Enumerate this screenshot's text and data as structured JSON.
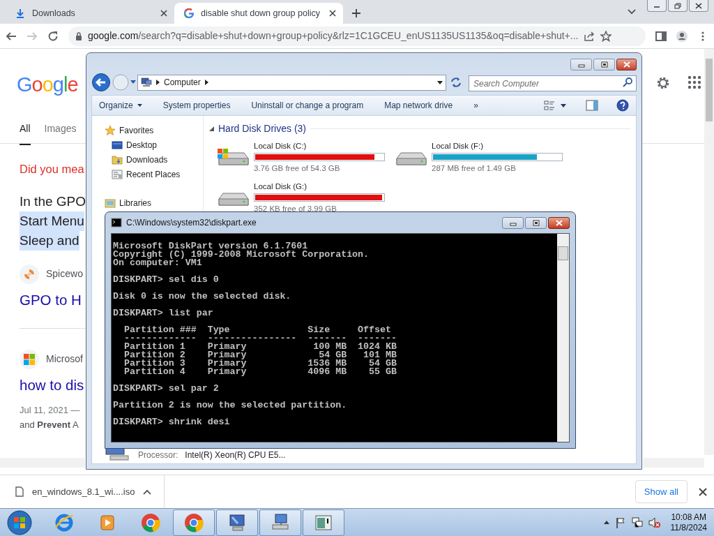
{
  "browser": {
    "tabs": [
      {
        "kind": "downloads",
        "title": "Downloads",
        "selected": false
      },
      {
        "kind": "google",
        "title": "disable shut down group policy",
        "selected": true
      }
    ],
    "back": {
      "disabled": false
    },
    "forward": {
      "disabled": true
    },
    "url": {
      "host": "google.com",
      "rest": "/search?q=disable+shut+down+group+policy&rlz=1C1GCEU_enUS1135US1135&oq=disable+shut+..."
    }
  },
  "google": {
    "logo": "Google",
    "search_tabs": [
      {
        "label": "All",
        "selected": true
      },
      {
        "label": "Images",
        "selected": false
      }
    ],
    "did_you_mean": "Did you mea",
    "snippet_lines": [
      {
        "text": "In the GPO",
        "highlighted": false
      },
      {
        "text": "Start Menu",
        "highlighted": true
      },
      {
        "text": "Sleep and",
        "highlighted": true
      }
    ],
    "results": [
      {
        "kind": "spiceworks",
        "source": "Spicewo",
        "title": "GPO to H"
      },
      {
        "kind": "microsoft",
        "source": "Microsof",
        "title": "how to dis",
        "date": "Jul 11, 2021 —",
        "snippet": "and **Prevent** A"
      }
    ]
  },
  "explorer": {
    "address": [
      "Computer"
    ],
    "search_placeholder": "Search Computer",
    "toolbar": [
      {
        "kind": "menu",
        "label": "Organize"
      },
      {
        "kind": "command",
        "label": "System properties"
      },
      {
        "kind": "command",
        "label": "Uninstall or change a program"
      },
      {
        "kind": "command",
        "label": "Map network drive"
      },
      {
        "kind": "command",
        "label": "»"
      }
    ],
    "nav": [
      {
        "kind": "favorites",
        "label": "Favorites",
        "children": [
          {
            "kind": "desktop",
            "label": "Desktop"
          },
          {
            "kind": "downloads",
            "label": "Downloads"
          },
          {
            "kind": "recent",
            "label": "Recent Places"
          }
        ]
      },
      {
        "kind": "libraries",
        "label": "Libraries"
      }
    ],
    "group": {
      "title": "Hard Disk Drives (3)",
      "expanded": true
    },
    "drives": [
      {
        "name": "Local Disk (C:)",
        "system": true,
        "level": 0.93,
        "color": "#e01010",
        "free": "3.76 GB free of 54.3 GB"
      },
      {
        "name": "Local Disk (F:)",
        "system": false,
        "level": 0.81,
        "color": "#1ba3c6",
        "free": "287 MB free of 1.49 GB"
      },
      {
        "name": "Local Disk (G:)",
        "system": false,
        "level": 0.99,
        "color": "#e01010",
        "free": "352 KB free of 3.99 GB"
      }
    ],
    "details": {
      "label": "Processor:",
      "value": "Intel(R) Xeon(R) CPU E5..."
    }
  },
  "console": {
    "title": "C:\\Windows\\system32\\diskpart.exe",
    "blocks": [
      [
        "Microsoft DiskPart version 6.1.7601",
        "Copyright (C) 1999-2008 Microsoft Corporation.",
        "On computer: VM1"
      ],
      [
        "DISKPART> sel dis 0"
      ],
      [
        "Disk 0 is now the selected disk."
      ],
      [
        "DISKPART> list par"
      ],
      [
        "  Partition ###  Type              Size     Offset",
        "  -------------  ----------------  -------  -------",
        "  Partition 1    Primary            100 MB  1024 KB",
        "  Partition 2    Primary             54 GB   101 MB",
        "  Partition 3    Primary           1536 MB    54 GB",
        "  Partition 4    Primary           4096 MB    55 GB"
      ],
      [
        "DISKPART> sel par 2"
      ],
      [
        "Partition 2 is now the selected partition."
      ],
      [
        "DISKPART> shrink desi"
      ]
    ]
  },
  "downloads_bar": {
    "file": "en_windows_8.1_wi....iso",
    "show_all": "Show all"
  },
  "taskbar": {
    "apps": [
      {
        "kind": "ie",
        "running": false
      },
      {
        "kind": "media",
        "running": false
      },
      {
        "kind": "chrome",
        "running": false
      },
      {
        "kind": "chrome",
        "running": true
      },
      {
        "kind": "computer",
        "running": true
      },
      {
        "kind": "network",
        "running": true
      },
      {
        "kind": "console",
        "running": true
      }
    ],
    "clock": {
      "time": "10:08 AM",
      "date": "11/8/2024"
    }
  }
}
